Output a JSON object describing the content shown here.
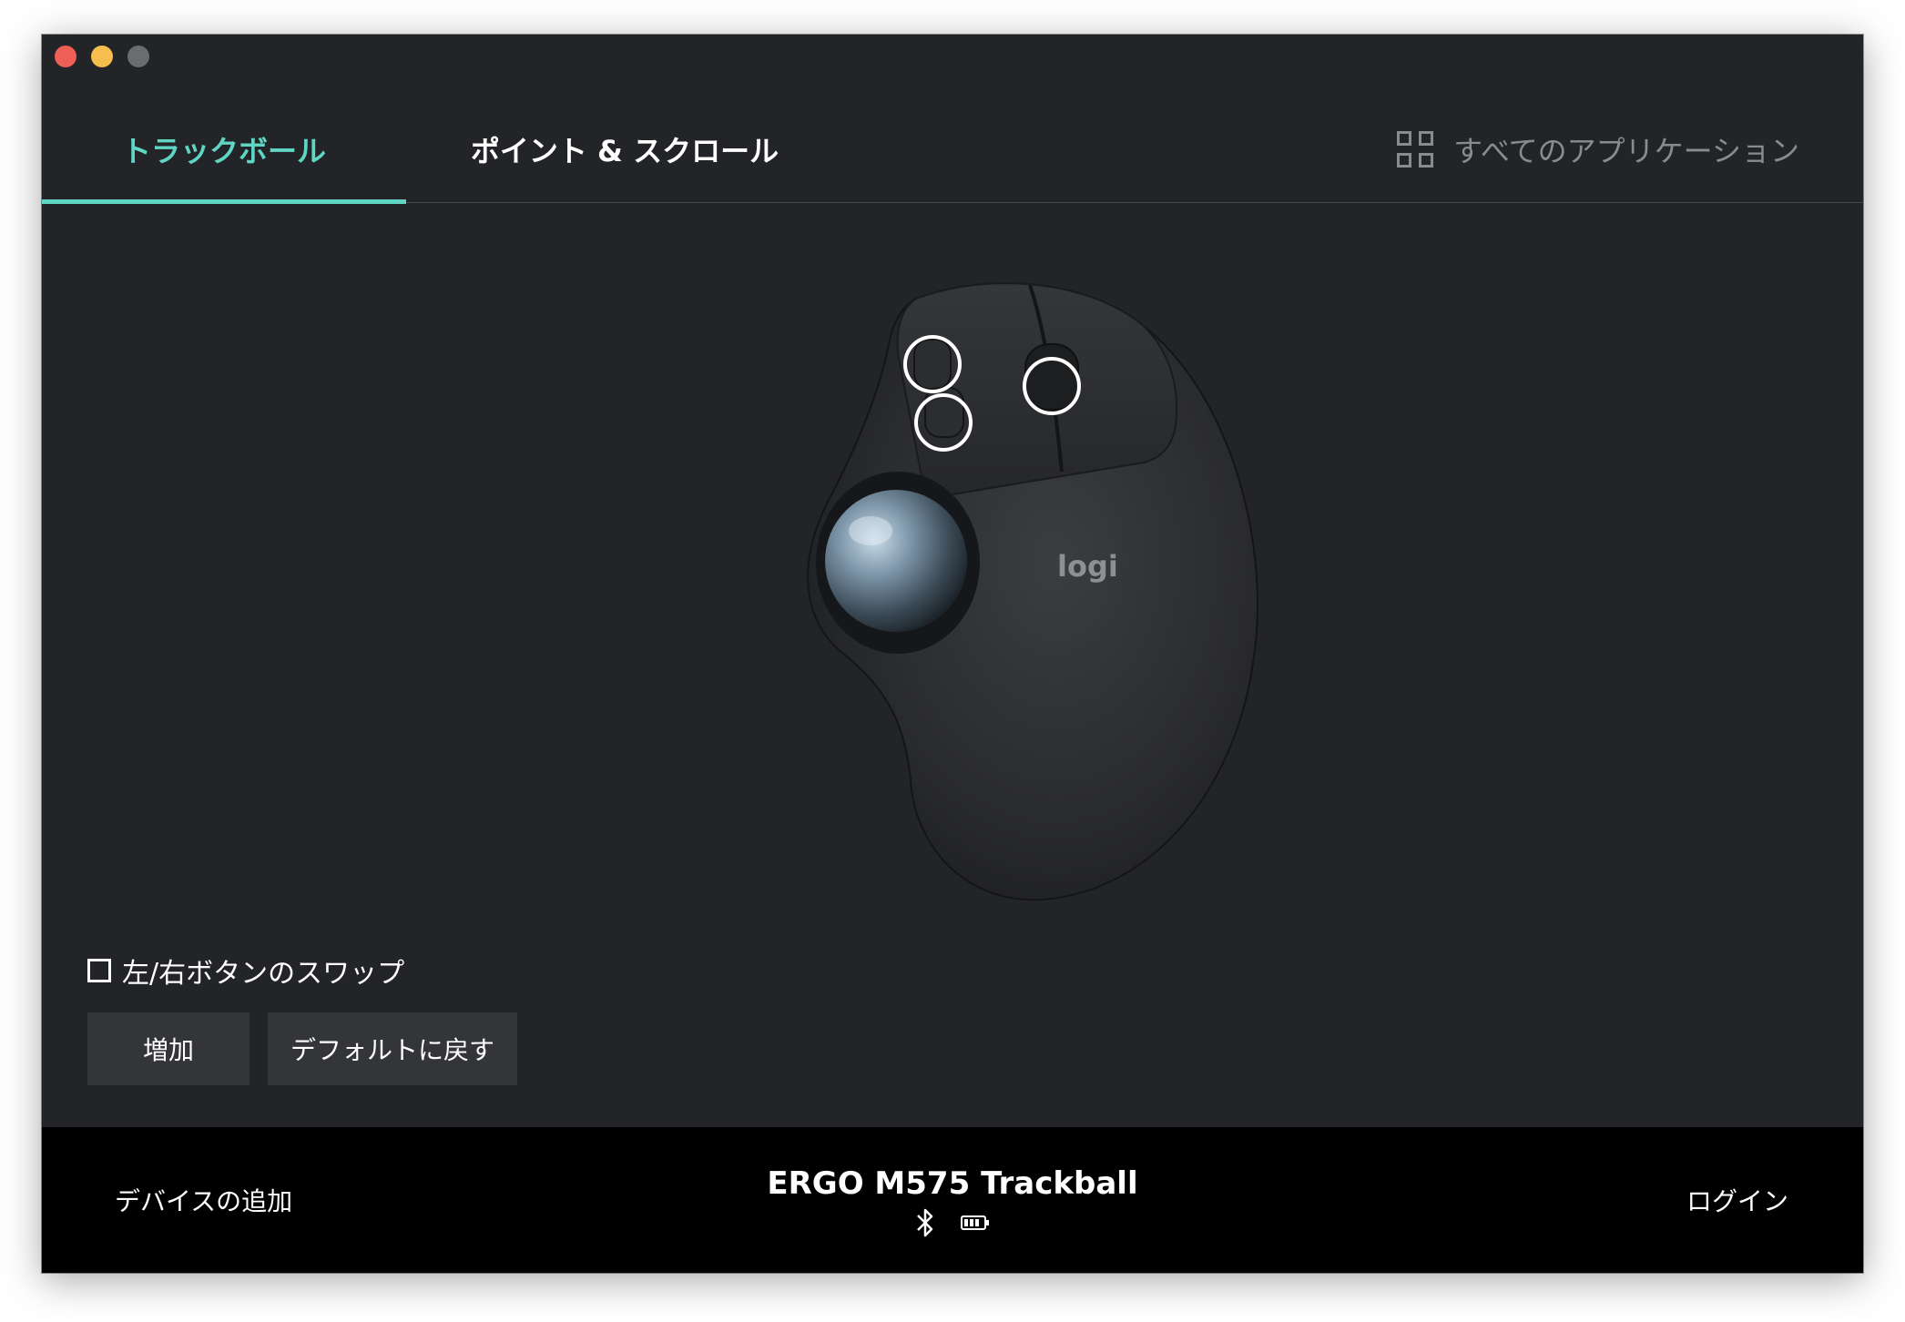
{
  "tabs": [
    {
      "label": "トラックボール",
      "active": true
    },
    {
      "label": "ポイント & スクロール",
      "active": false
    }
  ],
  "app_selector": {
    "label": "すべてのアプリケーション",
    "icon": "grid-icon"
  },
  "device_image": {
    "brand_mark": "logi"
  },
  "options": {
    "swap_label": "左/右ボタンのスワップ",
    "swap_checked": false
  },
  "buttons": {
    "add": "増加",
    "reset": "デフォルトに戻す"
  },
  "footer": {
    "add_device": "デバイスの追加",
    "device_name": "ERGO M575 Trackball",
    "connection_icon": "bluetooth-icon",
    "battery_icon": "battery-icon",
    "login": "ログイン"
  },
  "colors": {
    "accent": "#5fd6c4",
    "background": "#232427",
    "footer": "#000000"
  }
}
